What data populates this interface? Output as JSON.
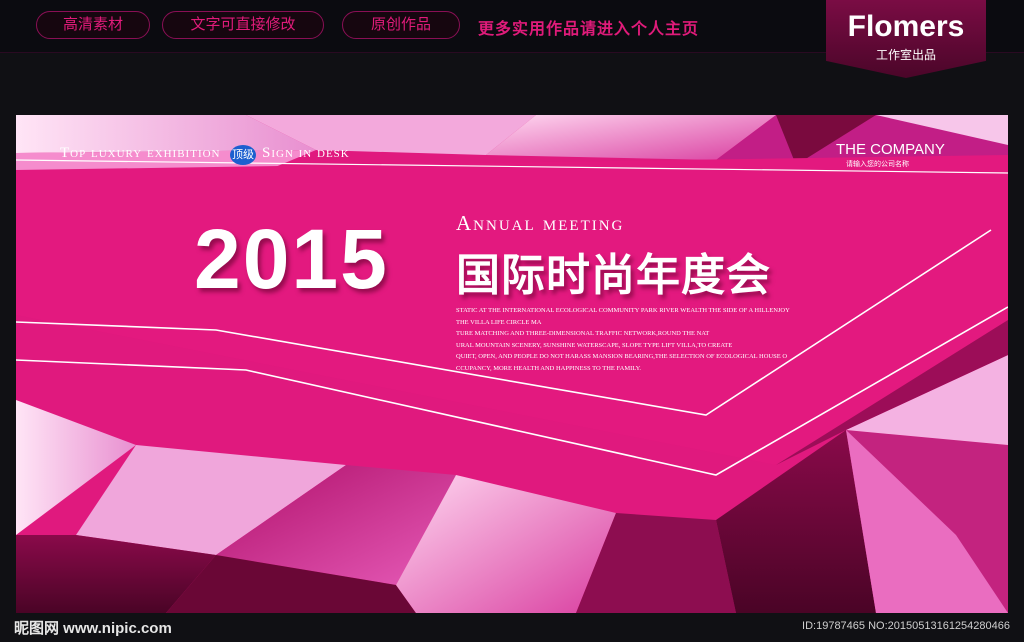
{
  "topbar": {
    "pills": [
      "高清素材",
      "文字可直接修改",
      "原创作品"
    ],
    "tagline": "更多实用作品请进入个人主页"
  },
  "brand": {
    "name": "Flomers",
    "sub": "工作室出品"
  },
  "banner": {
    "top_left": "Top luxury exhibition",
    "badge": "顶级",
    "sign": "Sign in desk",
    "company": "THE COMPANY",
    "company_sub": "请输入您的公司名称",
    "year": "2015",
    "annual": "Annual meeting",
    "cn_title": "国际时尚年度会",
    "body_lines": [
      "STATIC AT THE INTERNATIONAL ECOLOGICAL COMMUNITY PARK RIVER WEALTH THE SIDE OF A HILLENJOY",
      "THE VILLA LIFE CIRCLE MA",
      "TURE MATCHING AND THREE-DIMENSIONAL TRAFFIC NETWORK,ROUND THE NAT",
      "URAL MOUNTAIN SCENERY, SUNSHINE WATERSCAPE, SLOPE TYPE LIFT VILLA,TO CREATE",
      "QUIET, OPEN, AND PEOPLE DO NOT HARASS MANSION BEARING,THE SELECTION OF ECOLOGICAL HOUSE O",
      "CCUPANCY, MORE HEALTH AND HAPPINESS TO THE FAMILY."
    ]
  },
  "footer": {
    "watermark": "昵图网 www.nipic.com",
    "id_text": "ID:19787465 NO:20150513161254280466"
  },
  "colors": {
    "accent": "#e01b7a",
    "banner_pink": "#e0197e",
    "dark_bg": "#101014"
  }
}
